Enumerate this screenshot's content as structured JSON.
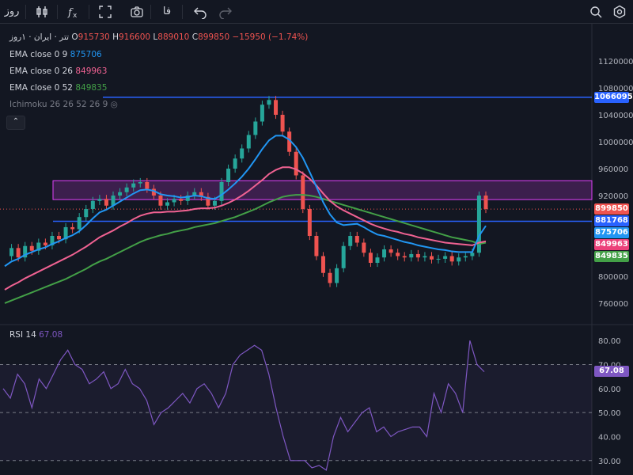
{
  "toolbar": {
    "interval": "روز",
    "fa_label": "فا"
  },
  "legend": {
    "symbol": "تتر · ایران · ۱روز",
    "o_label": "O",
    "o_val": "915730",
    "h_label": "H",
    "h_val": "916600",
    "l_label": "L",
    "l_val": "889010",
    "c_label": "C",
    "c_val": "899850",
    "change": "−15950 (−1.74%)",
    "ema1_label": "EMA close 0 9",
    "ema1_val": "875706",
    "ema2_label": "EMA close 0 26",
    "ema2_val": "849963",
    "ema3_label": "EMA close 0 52",
    "ema3_val": "849835",
    "ichimoku_label": "Ichimoku 26 26 52 26 9",
    "rsi_label": "RSI 14",
    "rsi_val": "67.08"
  },
  "colors": {
    "up": "#26a69a",
    "down": "#ef5350",
    "ema9": "#2196f3",
    "ema26": "#f06292",
    "ema52": "#43a047",
    "rsi": "#7e57c2",
    "zone": "#e040fb",
    "hline": "#2962ff"
  },
  "badges": [
    {
      "value": "1066095",
      "color": "#2962ff",
      "price": 1066095
    },
    {
      "value": "899850",
      "color": "#ef5350",
      "price": 899850
    },
    {
      "value": "881768",
      "color": "#2962ff",
      "price": 881768
    },
    {
      "value": "875706",
      "color": "#2196f3",
      "price": 875706
    },
    {
      "value": "849963",
      "color": "#ec407a",
      "price": 849963
    },
    {
      "value": "849835",
      "color": "#43a047",
      "price": 849835
    }
  ],
  "rsi_badge": {
    "value": "67.08",
    "color": "#7e57c2"
  },
  "chart_data": {
    "type": "candlestick",
    "price_axis": {
      "ticks": [
        "1120000",
        "1080000",
        "1040000",
        "1000000",
        "960000",
        "920000",
        "800000",
        "760000"
      ],
      "ylim": [
        740000,
        1140000
      ]
    },
    "rsi_axis": {
      "ticks": [
        "80.00",
        "70.00",
        "60.00",
        "50.00",
        "40.00",
        "30.00"
      ],
      "ylim": [
        24,
        86
      ],
      "levels": [
        70,
        50,
        30
      ]
    },
    "horizontal_lines": [
      1066095,
      881768
    ],
    "zone": {
      "top": 942000,
      "bottom": 914000
    },
    "price": [
      830,
      842,
      828,
      845,
      838,
      850,
      846,
      860,
      855,
      873,
      870,
      888,
      900,
      912,
      915,
      905,
      920,
      925,
      932,
      938,
      940,
      930,
      920,
      905,
      910,
      915,
      912,
      920,
      925,
      918,
      905,
      912,
      940,
      960,
      975,
      990,
      1010,
      1030,
      1055,
      1062,
      1040,
      1015,
      985,
      950,
      900,
      860,
      830,
      805,
      790,
      812,
      845,
      860,
      850,
      835,
      820,
      828,
      840,
      835,
      830,
      828,
      833,
      828,
      830,
      825,
      826,
      830,
      822,
      828,
      830,
      835,
      920,
      900
    ],
    "ema9": [
      815,
      822,
      826,
      832,
      836,
      840,
      843,
      848,
      852,
      857,
      861,
      867,
      876,
      886,
      895,
      899,
      905,
      911,
      917,
      923,
      928,
      929,
      927,
      922,
      920,
      919,
      917,
      918,
      920,
      919,
      916,
      915,
      921,
      929,
      938,
      948,
      960,
      974,
      989,
      1002,
      1009,
      1009,
      1003,
      992,
      976,
      955,
      933,
      910,
      892,
      880,
      876,
      877,
      878,
      873,
      867,
      862,
      860,
      857,
      854,
      851,
      849,
      846,
      844,
      842,
      840,
      839,
      837,
      836,
      836,
      836,
      860,
      875
    ],
    "ema26": [
      780,
      786,
      791,
      797,
      802,
      807,
      812,
      817,
      822,
      827,
      832,
      838,
      844,
      851,
      858,
      863,
      868,
      874,
      879,
      885,
      890,
      893,
      895,
      895,
      896,
      896,
      897,
      898,
      900,
      901,
      901,
      902,
      905,
      909,
      914,
      920,
      927,
      935,
      943,
      952,
      958,
      962,
      962,
      959,
      953,
      945,
      935,
      923,
      912,
      904,
      898,
      893,
      888,
      883,
      878,
      874,
      871,
      868,
      866,
      863,
      861,
      858,
      856,
      854,
      852,
      850,
      849,
      848,
      847,
      846,
      850,
      852
    ],
    "ema52": [
      760,
      764,
      768,
      772,
      776,
      780,
      784,
      788,
      792,
      796,
      801,
      806,
      811,
      817,
      822,
      826,
      831,
      836,
      841,
      846,
      851,
      855,
      858,
      861,
      863,
      866,
      868,
      870,
      873,
      875,
      877,
      879,
      882,
      885,
      888,
      892,
      896,
      900,
      905,
      910,
      914,
      918,
      920,
      921,
      921,
      920,
      918,
      915,
      912,
      909,
      906,
      903,
      900,
      897,
      894,
      891,
      888,
      885,
      882,
      879,
      876,
      873,
      870,
      867,
      864,
      861,
      858,
      856,
      854,
      852,
      848,
      850
    ],
    "rsi": [
      60,
      56,
      66,
      62,
      52,
      64,
      60,
      66,
      72,
      76,
      70,
      68,
      62,
      64,
      67,
      60,
      62,
      68,
      62,
      60,
      55,
      45,
      50,
      52,
      55,
      58,
      54,
      60,
      62,
      58,
      52,
      58,
      70,
      74,
      76,
      78,
      76,
      66,
      52,
      40,
      30,
      30,
      30,
      27,
      28,
      26,
      40,
      48,
      42,
      46,
      50,
      52,
      42,
      44,
      40,
      42,
      43,
      44,
      44,
      40,
      58,
      50,
      62,
      58,
      50,
      80,
      70,
      67
    ],
    "title": "",
    "xlabel": "",
    "ylabel": ""
  }
}
